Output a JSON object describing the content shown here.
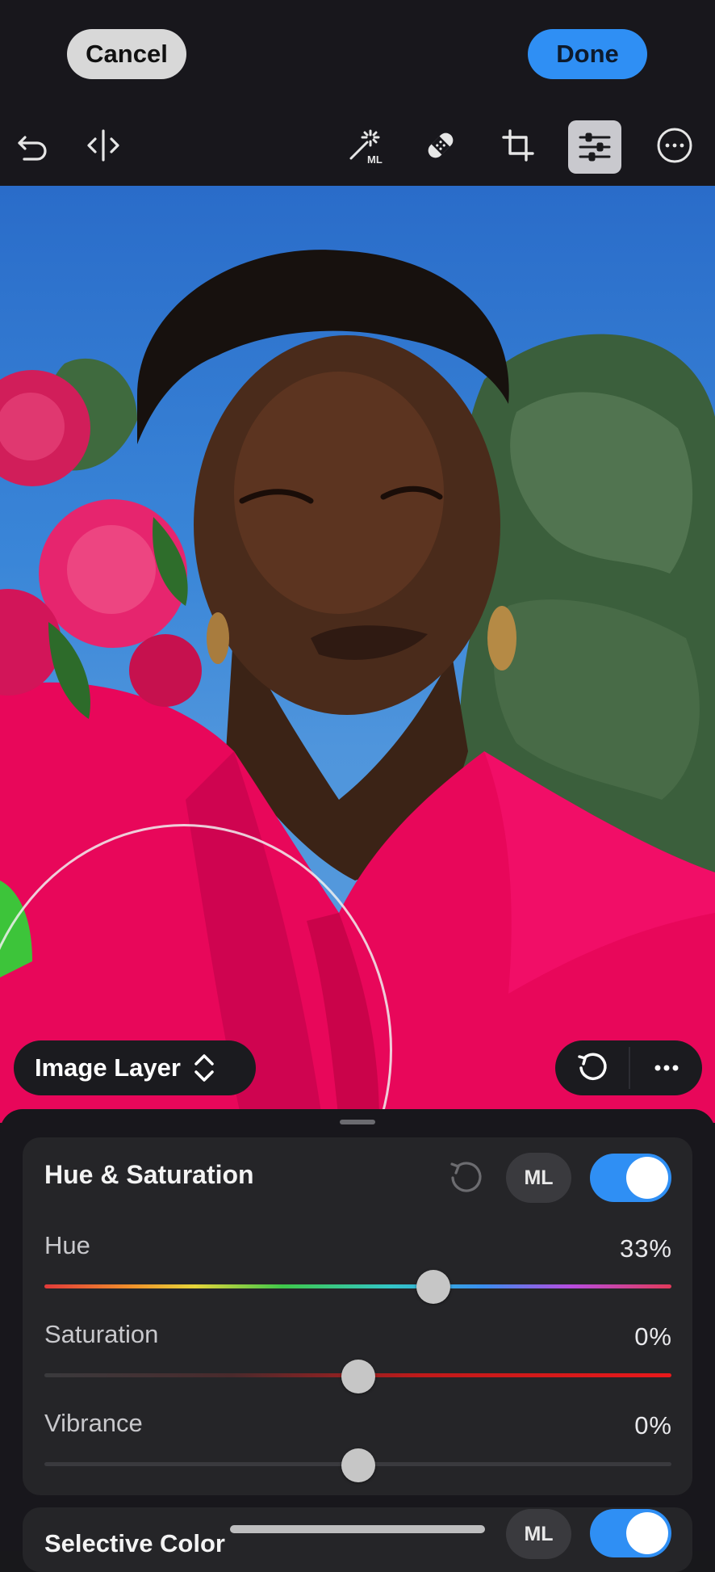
{
  "header": {
    "cancel_label": "Cancel",
    "done_label": "Done",
    "accent_color": "#2f8ff4"
  },
  "toolbar": {
    "tools": [
      "undo-icon",
      "compare-icon",
      "magic-wand-ml-icon",
      "healing-bandage-icon",
      "crop-icon",
      "adjustments-sliders-icon",
      "more-icon"
    ],
    "ml_badge": "ML",
    "active_tool": "adjustments-sliders-icon"
  },
  "canvas": {
    "layer_selector_label": "Image Layer",
    "layer_actions": [
      "reset-icon",
      "more-icon"
    ]
  },
  "panel": {
    "title": "Hue & Saturation",
    "ml_chip": "ML",
    "enabled": true,
    "sliders": [
      {
        "label": "Hue",
        "value": "33%",
        "position": 0.62
      },
      {
        "label": "Saturation",
        "value": "0%",
        "position": 0.5
      },
      {
        "label": "Vibrance",
        "value": "0%",
        "position": 0.5
      }
    ]
  },
  "next_panel": {
    "title": "Selective Color",
    "ml_chip": "ML",
    "enabled": true
  }
}
